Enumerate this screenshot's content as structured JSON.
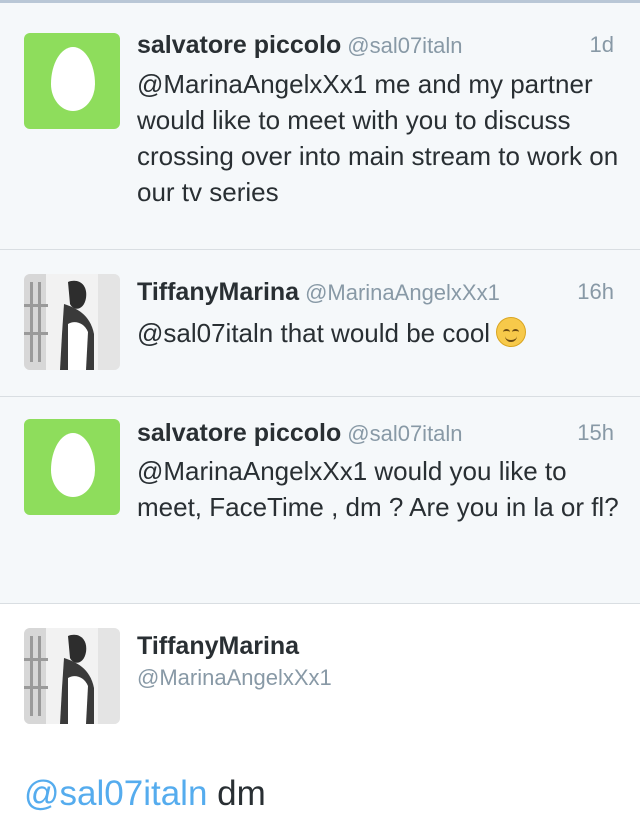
{
  "tweets": [
    {
      "name": "salvatore piccolo",
      "handle": "@sal07italn",
      "time": "1d",
      "text": "@MarinaAngelxXx1 me and my partner would like to meet with you to discuss crossing over into main stream to work on our tv series",
      "avatar": "egg-icon"
    },
    {
      "name": "TiffanyMarina",
      "handle": "@MarinaAngelxXx1",
      "time": "16h",
      "text": "@sal07italn that would be cool",
      "emoji": "relieved-face-emoji",
      "avatar": "profile-photo"
    },
    {
      "name": "salvatore piccolo",
      "handle": "@sal07italn",
      "time": "15h",
      "text": "@MarinaAngelxXx1 would you like to meet, FaceTime , dm ? Are you in la or fl?",
      "avatar": "egg-icon"
    }
  ],
  "main_tweet": {
    "name": "TiffanyMarina",
    "handle": "@MarinaAngelxXx1",
    "mention": "@sal07italn",
    "text": " dm",
    "avatar": "profile-photo"
  },
  "colors": {
    "egg_green": "#8edd5c",
    "link_blue": "#55acee",
    "muted": "#8899a6",
    "tweet_bg": "#f5f8fa"
  }
}
